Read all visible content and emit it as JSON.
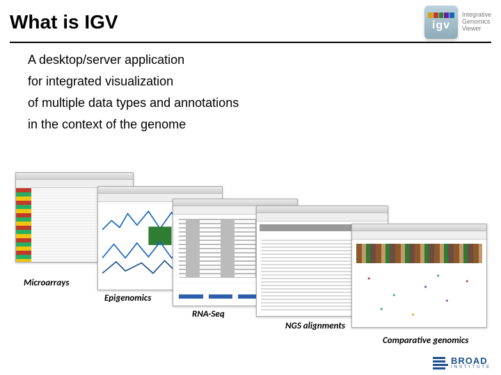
{
  "title": "What is IGV",
  "logo": {
    "acronym": "igv",
    "full": "Integrative\nGenomics\nViewer"
  },
  "lines": [
    "A desktop/server application",
    "for integrated visualization",
    "of multiple data types and annotations",
    "in the context of the genome"
  ],
  "captions": {
    "microarrays": "Microarrays",
    "epigenomics": "Epigenomics",
    "rnaseq": "RNA-Seq",
    "ngs": "NGS alignments",
    "comparative": "Comparative genomics"
  },
  "footer": {
    "name": "BROAD",
    "sub": "INSTITUTE"
  }
}
